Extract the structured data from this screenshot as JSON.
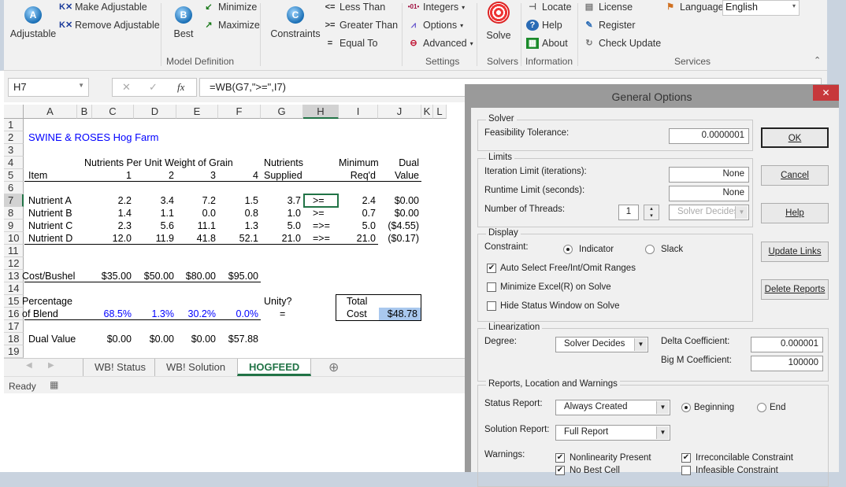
{
  "ribbon": {
    "adjustable": "Adjustable",
    "make_adjustable": "Make Adjustable",
    "remove_adjustable": "Remove Adjustable",
    "best": "Best",
    "minimize": "Minimize",
    "maximize": "Maximize",
    "constraints": "Constraints",
    "less_than": "Less Than",
    "greater_than": "Greater Than",
    "equal_to": "Equal To",
    "integers": "Integers",
    "options": "Options",
    "advanced": "Advanced",
    "solve": "Solve",
    "locate": "Locate",
    "help": "Help",
    "about": "About",
    "license": "License",
    "register": "Register",
    "check_update": "Check Update",
    "language_label": "Language",
    "language_value": "English",
    "groups": {
      "model_definition": "Model Definition",
      "settings": "Settings",
      "solvers": "Solvers",
      "information": "Information",
      "services": "Services"
    },
    "icon_letters": {
      "adjustable": "A",
      "best": "B",
      "constraints": "C",
      "less_than": "<=",
      "greater_than": ">=",
      "equal_to": "="
    }
  },
  "formula_bar": {
    "name_box": "H7",
    "formula": "=WB(G7,\">=\",I7)",
    "fx": "fx",
    "cancel": "✕",
    "enter": "✓"
  },
  "sheet": {
    "columns": [
      "A",
      "B",
      "C",
      "D",
      "E",
      "F",
      "G",
      "H",
      "I",
      "J",
      "K",
      "L"
    ],
    "rows": [
      "1",
      "2",
      "3",
      "4",
      "5",
      "6",
      "7",
      "8",
      "9",
      "10",
      "11",
      "12",
      "13",
      "14",
      "15",
      "16",
      "17",
      "18",
      "19"
    ],
    "cells": [
      {
        "r": 2,
        "c": "A",
        "v": "SWINE & ROSES Hog Farm",
        "color": "#0000ff"
      },
      {
        "r": 4,
        "c": "C",
        "v": "Nutrients Per Unit Weight of Grain"
      },
      {
        "r": 4,
        "c": "G",
        "v": "Nutrients"
      },
      {
        "r": 4,
        "c": "I",
        "v": "Minimum"
      },
      {
        "r": 4,
        "c": "J",
        "v": "Dual"
      },
      {
        "r": 5,
        "c": "A",
        "v": "Item"
      },
      {
        "r": 5,
        "c": "C",
        "v": "1"
      },
      {
        "r": 5,
        "c": "D",
        "v": "2"
      },
      {
        "r": 5,
        "c": "E",
        "v": "3"
      },
      {
        "r": 5,
        "c": "F",
        "v": "4"
      },
      {
        "r": 5,
        "c": "G",
        "v": "Supplied"
      },
      {
        "r": 5,
        "c": "I",
        "v": "Req'd"
      },
      {
        "r": 5,
        "c": "J",
        "v": "Value"
      },
      {
        "r": 7,
        "c": "A",
        "v": "Nutrient A"
      },
      {
        "r": 7,
        "c": "C",
        "v": "2.2"
      },
      {
        "r": 7,
        "c": "D",
        "v": "3.4"
      },
      {
        "r": 7,
        "c": "E",
        "v": "7.2"
      },
      {
        "r": 7,
        "c": "F",
        "v": "1.5"
      },
      {
        "r": 7,
        "c": "G",
        "v": "3.7"
      },
      {
        "r": 7,
        "c": "H",
        "v": ">="
      },
      {
        "r": 7,
        "c": "I",
        "v": "2.4"
      },
      {
        "r": 7,
        "c": "J",
        "v": "$0.00"
      },
      {
        "r": 8,
        "c": "A",
        "v": "Nutrient B"
      },
      {
        "r": 8,
        "c": "C",
        "v": "1.4"
      },
      {
        "r": 8,
        "c": "D",
        "v": "1.1"
      },
      {
        "r": 8,
        "c": "E",
        "v": "0.0"
      },
      {
        "r": 8,
        "c": "F",
        "v": "0.8"
      },
      {
        "r": 8,
        "c": "G",
        "v": "1.0"
      },
      {
        "r": 8,
        "c": "H",
        "v": ">="
      },
      {
        "r": 8,
        "c": "I",
        "v": "0.7"
      },
      {
        "r": 8,
        "c": "J",
        "v": "$0.00"
      },
      {
        "r": 9,
        "c": "A",
        "v": "Nutrient C"
      },
      {
        "r": 9,
        "c": "C",
        "v": "2.3"
      },
      {
        "r": 9,
        "c": "D",
        "v": "5.6"
      },
      {
        "r": 9,
        "c": "E",
        "v": "11.1"
      },
      {
        "r": 9,
        "c": "F",
        "v": "1.3"
      },
      {
        "r": 9,
        "c": "G",
        "v": "5.0"
      },
      {
        "r": 9,
        "c": "H",
        "v": "=>="
      },
      {
        "r": 9,
        "c": "I",
        "v": "5.0"
      },
      {
        "r": 9,
        "c": "J",
        "v": "($4.55)"
      },
      {
        "r": 10,
        "c": "A",
        "v": "Nutrient D"
      },
      {
        "r": 10,
        "c": "C",
        "v": "12.0"
      },
      {
        "r": 10,
        "c": "D",
        "v": "11.9"
      },
      {
        "r": 10,
        "c": "E",
        "v": "41.8"
      },
      {
        "r": 10,
        "c": "F",
        "v": "52.1"
      },
      {
        "r": 10,
        "c": "G",
        "v": "21.0"
      },
      {
        "r": 10,
        "c": "H",
        "v": "=>="
      },
      {
        "r": 10,
        "c": "I",
        "v": "21.0"
      },
      {
        "r": 10,
        "c": "J",
        "v": "($0.17)"
      },
      {
        "r": 13,
        "c": "A",
        "v": "Cost/Bushel"
      },
      {
        "r": 13,
        "c": "C",
        "v": "$35.00"
      },
      {
        "r": 13,
        "c": "D",
        "v": "$50.00"
      },
      {
        "r": 13,
        "c": "E",
        "v": "$80.00"
      },
      {
        "r": 13,
        "c": "F",
        "v": "$95.00"
      },
      {
        "r": 15,
        "c": "A",
        "v": "Percentage"
      },
      {
        "r": 15,
        "c": "G",
        "v": "Unity?"
      },
      {
        "r": 15,
        "c": "I",
        "v": "Total"
      },
      {
        "r": 16,
        "c": "A",
        "v": "of Blend"
      },
      {
        "r": 16,
        "c": "C",
        "v": "68.5%",
        "color": "#0000ff"
      },
      {
        "r": 16,
        "c": "D",
        "v": "1.3%",
        "color": "#0000ff"
      },
      {
        "r": 16,
        "c": "E",
        "v": "30.2%",
        "color": "#0000ff"
      },
      {
        "r": 16,
        "c": "F",
        "v": "0.0%",
        "color": "#0000ff"
      },
      {
        "r": 16,
        "c": "G",
        "v": "="
      },
      {
        "r": 16,
        "c": "I",
        "v": "Cost"
      },
      {
        "r": 16,
        "c": "J",
        "v": "$48.78"
      },
      {
        "r": 18,
        "c": "A",
        "v": "Dual Value"
      },
      {
        "r": 18,
        "c": "C",
        "v": "$0.00"
      },
      {
        "r": 18,
        "c": "D",
        "v": "$0.00"
      },
      {
        "r": 18,
        "c": "E",
        "v": "$0.00"
      },
      {
        "r": 18,
        "c": "F",
        "v": "$57.88"
      }
    ],
    "selected_cell": "H7"
  },
  "tabs": [
    {
      "label": "WB! Status"
    },
    {
      "label": "WB! Solution"
    },
    {
      "label": "HOGFEED",
      "active": true
    }
  ],
  "status": {
    "text": "Ready"
  },
  "dialog": {
    "title": "General Options",
    "close": "✕",
    "solver": {
      "legend": "Solver",
      "feas_label": "Feasibility Tolerance:",
      "feas_value": "0.0000001"
    },
    "limits": {
      "legend": "Limits",
      "iter_label": "Iteration Limit (iterations):",
      "iter_value": "None",
      "runtime_label": "Runtime Limit (seconds):",
      "runtime_value": "None",
      "threads_label": "Number of Threads:",
      "threads_value": "1",
      "threads_mode": "Solver Decides"
    },
    "display": {
      "legend": "Display",
      "constraint_label": "Constraint:",
      "indicator": "Indicator",
      "slack": "Slack",
      "constraint_selected": "Indicator",
      "auto_select": "Auto Select Free/Int/Omit Ranges",
      "auto_select_checked": true,
      "minimize_excel": "Minimize Excel(R) on Solve",
      "minimize_excel_checked": false,
      "hide_status": "Hide Status Window on Solve",
      "hide_status_checked": false
    },
    "linearization": {
      "legend": "Linearization",
      "degree_label": "Degree:",
      "degree_value": "Solver Decides",
      "delta_label": "Delta Coefficient:",
      "delta_value": "0.000001",
      "bigm_label": "Big M Coefficient:",
      "bigm_value": "100000"
    },
    "reports": {
      "legend": "Reports, Location and Warnings",
      "status_label": "Status Report:",
      "status_value": "Always Created",
      "beginning": "Beginning",
      "end": "End",
      "location_selected": "Beginning",
      "solution_label": "Solution Report:",
      "solution_value": "Full Report",
      "warnings_label": "Warnings:",
      "warnings": [
        {
          "label": "Nonlinearity Present",
          "checked": true
        },
        {
          "label": "Irreconcilable Constraint",
          "checked": true
        },
        {
          "label": "No Best Cell",
          "checked": true
        },
        {
          "label": "Infeasible Constraint",
          "checked": false
        }
      ]
    },
    "buttons": {
      "ok": "OK",
      "cancel": "Cancel",
      "help": "Help",
      "update_links": "Update Links",
      "delete_reports": "Delete Reports"
    }
  }
}
